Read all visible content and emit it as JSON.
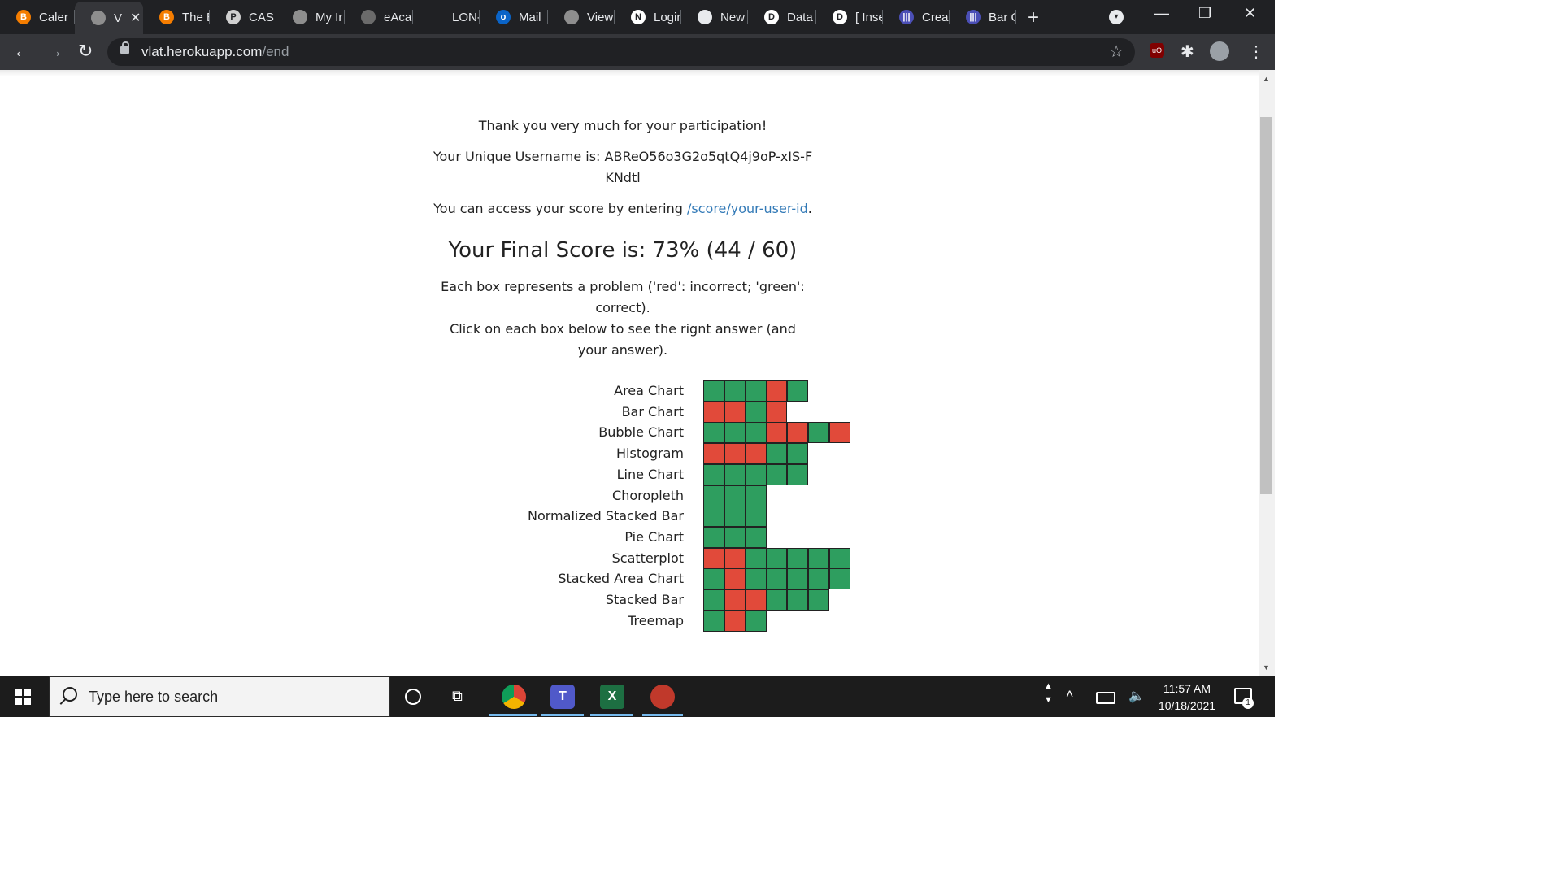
{
  "browser": {
    "tabs": [
      {
        "label": "Caler",
        "icon": "blogger-icon",
        "color": "#f57d00",
        "glyph": "B"
      },
      {
        "label": "V",
        "icon": "globe-icon",
        "color": "#8e8e8e",
        "glyph": "",
        "active": true
      },
      {
        "label": "The E",
        "icon": "blogger-icon",
        "color": "#f57d00",
        "glyph": "B"
      },
      {
        "label": "CAS",
        "icon": "document-icon",
        "color": "#d0d0d0",
        "glyph": "P"
      },
      {
        "label": "My Ir",
        "icon": "globe-icon",
        "color": "#8e8e8e",
        "glyph": ""
      },
      {
        "label": "eAcai",
        "icon": "book-icon",
        "color": "#6b6b6b",
        "glyph": ""
      },
      {
        "label": "LON-",
        "icon": "",
        "color": "",
        "glyph": ""
      },
      {
        "label": "Mail",
        "icon": "outlook-icon",
        "color": "#0a64c8",
        "glyph": "o"
      },
      {
        "label": "View",
        "icon": "globe-icon",
        "color": "#8e8e8e",
        "glyph": ""
      },
      {
        "label": "Login",
        "icon": "notion-icon",
        "color": "#ffffff",
        "glyph": "N"
      },
      {
        "label": "New",
        "icon": "openai-icon",
        "color": "#e8eaed",
        "glyph": ""
      },
      {
        "label": "Data",
        "icon": "d-icon",
        "color": "#ffffff",
        "glyph": "D"
      },
      {
        "label": "[ Inse",
        "icon": "d-icon",
        "color": "#ffffff",
        "glyph": "D"
      },
      {
        "label": "Creat",
        "icon": "chart-app-icon",
        "color": "#4b4fb6",
        "glyph": "|||"
      },
      {
        "label": "Bar C",
        "icon": "chart-app-icon",
        "color": "#4b4fb6",
        "glyph": "|||"
      }
    ],
    "url_host": "vlat.herokuapp.com",
    "url_path": "/end"
  },
  "page": {
    "thanks": "Thank you very much for your participation!",
    "username_line": "Your Unique Username is: ABReO56o3G2o5qtQ4j9oP-xIS-FKNdtl",
    "access_prefix": "You can access your score by entering ",
    "access_link": "/score/your-user-id",
    "access_suffix": ".",
    "final_score": "Your Final Score is: 73% (44 / 60)",
    "explain_1": "Each box represents a problem ('red': incorrect; 'green': correct).",
    "explain_2": "Click on each box below to see the rignt answer (and your answer).",
    "colors": {
      "correct": "#2e9e5f",
      "incorrect": "#e14a3a"
    },
    "results": [
      {
        "chart": "Area Chart",
        "answers": [
          1,
          1,
          1,
          0,
          1
        ]
      },
      {
        "chart": "Bar Chart",
        "answers": [
          0,
          0,
          1,
          0
        ]
      },
      {
        "chart": "Bubble Chart",
        "answers": [
          1,
          1,
          1,
          0,
          0,
          1,
          0
        ]
      },
      {
        "chart": "Histogram",
        "answers": [
          0,
          0,
          0,
          1,
          1
        ]
      },
      {
        "chart": "Line Chart",
        "answers": [
          1,
          1,
          1,
          1,
          1
        ]
      },
      {
        "chart": "Choropleth",
        "answers": [
          1,
          1,
          1
        ]
      },
      {
        "chart": "Normalized Stacked Bar",
        "answers": [
          1,
          1,
          1
        ]
      },
      {
        "chart": "Pie Chart",
        "answers": [
          1,
          1,
          1
        ]
      },
      {
        "chart": "Scatterplot",
        "answers": [
          0,
          0,
          1,
          1,
          1,
          1,
          1
        ]
      },
      {
        "chart": "Stacked Area Chart",
        "answers": [
          1,
          0,
          1,
          1,
          1,
          1,
          1
        ]
      },
      {
        "chart": "Stacked Bar",
        "answers": [
          1,
          0,
          0,
          1,
          1,
          1
        ]
      },
      {
        "chart": "Treemap",
        "answers": [
          1,
          0,
          1
        ]
      }
    ]
  },
  "taskbar": {
    "search_placeholder": "Type here to search",
    "time": "11:57 AM",
    "date": "10/18/2021",
    "notification_count": "1"
  }
}
